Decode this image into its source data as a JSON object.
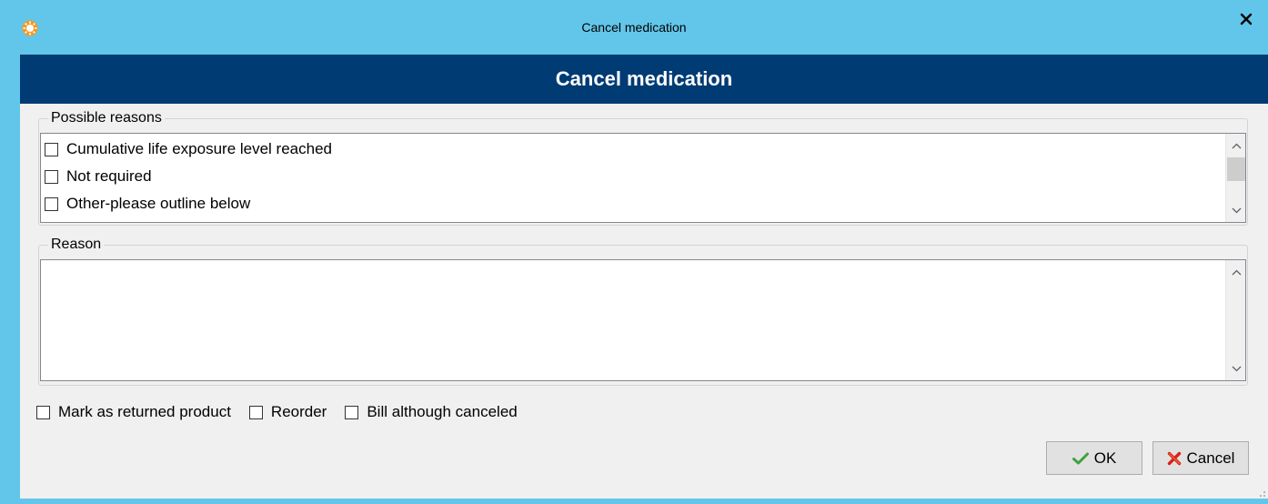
{
  "window": {
    "title": "Cancel medication",
    "app_icon": "sun-gear-icon",
    "close_label": "x",
    "frame_color": "#62c6ea"
  },
  "header": {
    "title": "Cancel medication",
    "background": "#003b73"
  },
  "possible_reasons": {
    "label": "Possible reasons",
    "items": [
      {
        "label": "Cumulative life exposure level reached",
        "checked": false
      },
      {
        "label": "Not required",
        "checked": false
      },
      {
        "label": "Other-please outline below",
        "checked": false
      }
    ]
  },
  "reason": {
    "label": "Reason",
    "value": ""
  },
  "options": {
    "returned_label": "Mark as returned product",
    "reorder_label": "Reorder",
    "bill_label": "Bill although canceled"
  },
  "buttons": {
    "ok_label": "OK",
    "cancel_label": "Cancel"
  }
}
